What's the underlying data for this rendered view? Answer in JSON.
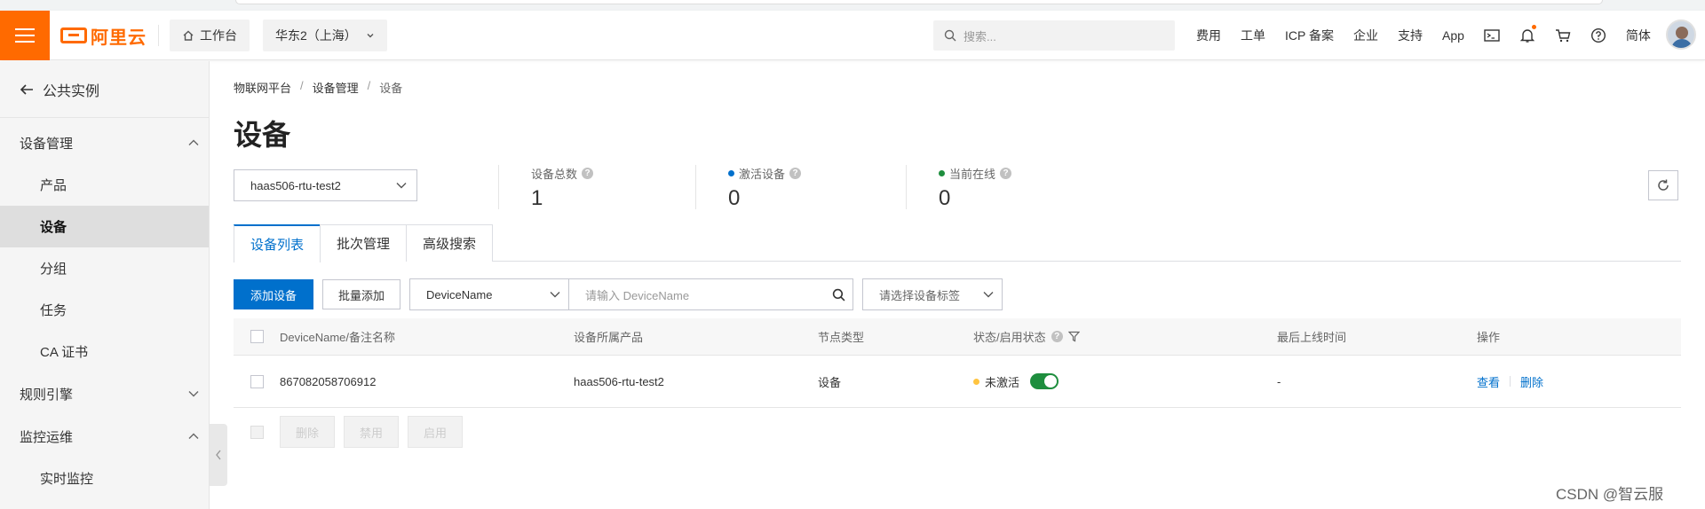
{
  "topbar": {
    "logo_text": "阿里云",
    "workbench": "工作台",
    "region": "华东2（上海）",
    "search_placeholder": "搜索...",
    "links": [
      "费用",
      "工单",
      "ICP 备案",
      "企业",
      "支持",
      "App"
    ],
    "lang": "简体",
    "icons": [
      "terminal-icon",
      "bell-icon",
      "cart-icon",
      "help-icon"
    ]
  },
  "sidebar": {
    "back_label": "公共实例",
    "groups": [
      {
        "label": "设备管理",
        "expanded": true,
        "items": [
          "产品",
          "设备",
          "分组",
          "任务",
          "CA 证书"
        ]
      },
      {
        "label": "规则引擎",
        "expanded": false,
        "items": []
      },
      {
        "label": "监控运维",
        "expanded": true,
        "items": [
          "实时监控"
        ]
      }
    ],
    "active_item": "设备"
  },
  "breadcrumb": [
    "物联网平台",
    "设备管理",
    "设备"
  ],
  "page_title": "设备",
  "product_select": "haas506-rtu-test2",
  "stats": [
    {
      "label": "设备总数",
      "value": "1",
      "dot": ""
    },
    {
      "label": "激活设备",
      "value": "0",
      "dot": "#0070cc"
    },
    {
      "label": "当前在线",
      "value": "0",
      "dot": "#1e8e3e"
    }
  ],
  "tabs": [
    "设备列表",
    "批次管理",
    "高级搜索"
  ],
  "toolbar": {
    "add_device": "添加设备",
    "batch_add": "批量添加",
    "field_select": "DeviceName",
    "search_placeholder": "请输入 DeviceName",
    "tag_select": "请选择设备标签"
  },
  "table": {
    "headers": [
      "DeviceName/备注名称",
      "设备所属产品",
      "节点类型",
      "状态/启用状态",
      "最后上线时间",
      "操作"
    ],
    "rows": [
      {
        "device_name": "867082058706912",
        "product": "haas506-rtu-test2",
        "node_type": "设备",
        "status": "未激活",
        "enabled": true,
        "last_online": "-",
        "actions": [
          "查看",
          "删除"
        ]
      }
    ]
  },
  "bulk_actions": [
    "删除",
    "禁用",
    "启用"
  ],
  "watermark": "CSDN @智云服",
  "colors": {
    "brand": "#ff6a00",
    "primary": "#0070cc",
    "success": "#1e8e3e",
    "warning": "#ffc440"
  }
}
